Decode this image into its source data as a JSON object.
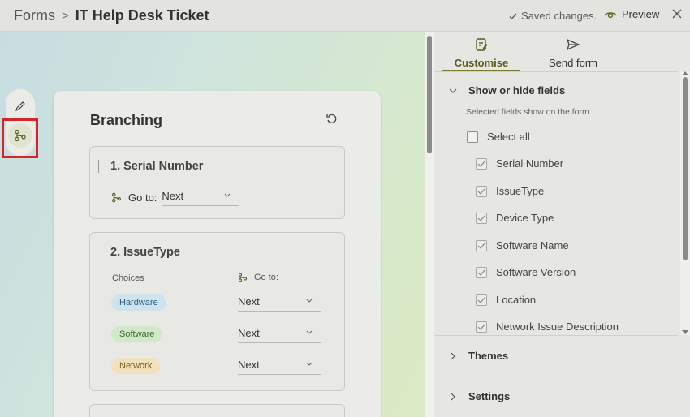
{
  "header": {
    "breadcrumb_root": "Forms",
    "breadcrumb_sep": ">",
    "title": "IT Help Desk Ticket",
    "saved_status": "Saved changes.",
    "preview_label": "Preview"
  },
  "branching": {
    "title": "Branching",
    "q1": {
      "title": "1. Serial Number",
      "goto_label": "Go to:",
      "goto_value": "Next"
    },
    "q2": {
      "title": "2. IssueType",
      "choices_label": "Choices",
      "goto_label": "Go to:",
      "choices": [
        {
          "label": "Hardware",
          "goto": "Next",
          "color": "#cfe3ee"
        },
        {
          "label": "Software",
          "goto": "Next",
          "color": "#d1e8c9"
        },
        {
          "label": "Network",
          "goto": "Next",
          "color": "#f2e1bc"
        }
      ]
    }
  },
  "panel": {
    "tabs": [
      {
        "label": "Customise",
        "icon": "customise-icon",
        "active": true
      },
      {
        "label": "Send form",
        "icon": "send-icon",
        "active": false
      }
    ],
    "show_hide": {
      "title": "Show or hide fields",
      "hint": "Selected fields show on the form",
      "select_all": "Select all",
      "fields": [
        "Serial Number",
        "IssueType",
        "Device Type",
        "Software Name",
        "Software Version",
        "Location",
        "Network Issue Description"
      ]
    },
    "themes": "Themes",
    "settings": "Settings"
  },
  "colors": {
    "accent": "#7a7a2e",
    "highlight": "#d4242c"
  }
}
